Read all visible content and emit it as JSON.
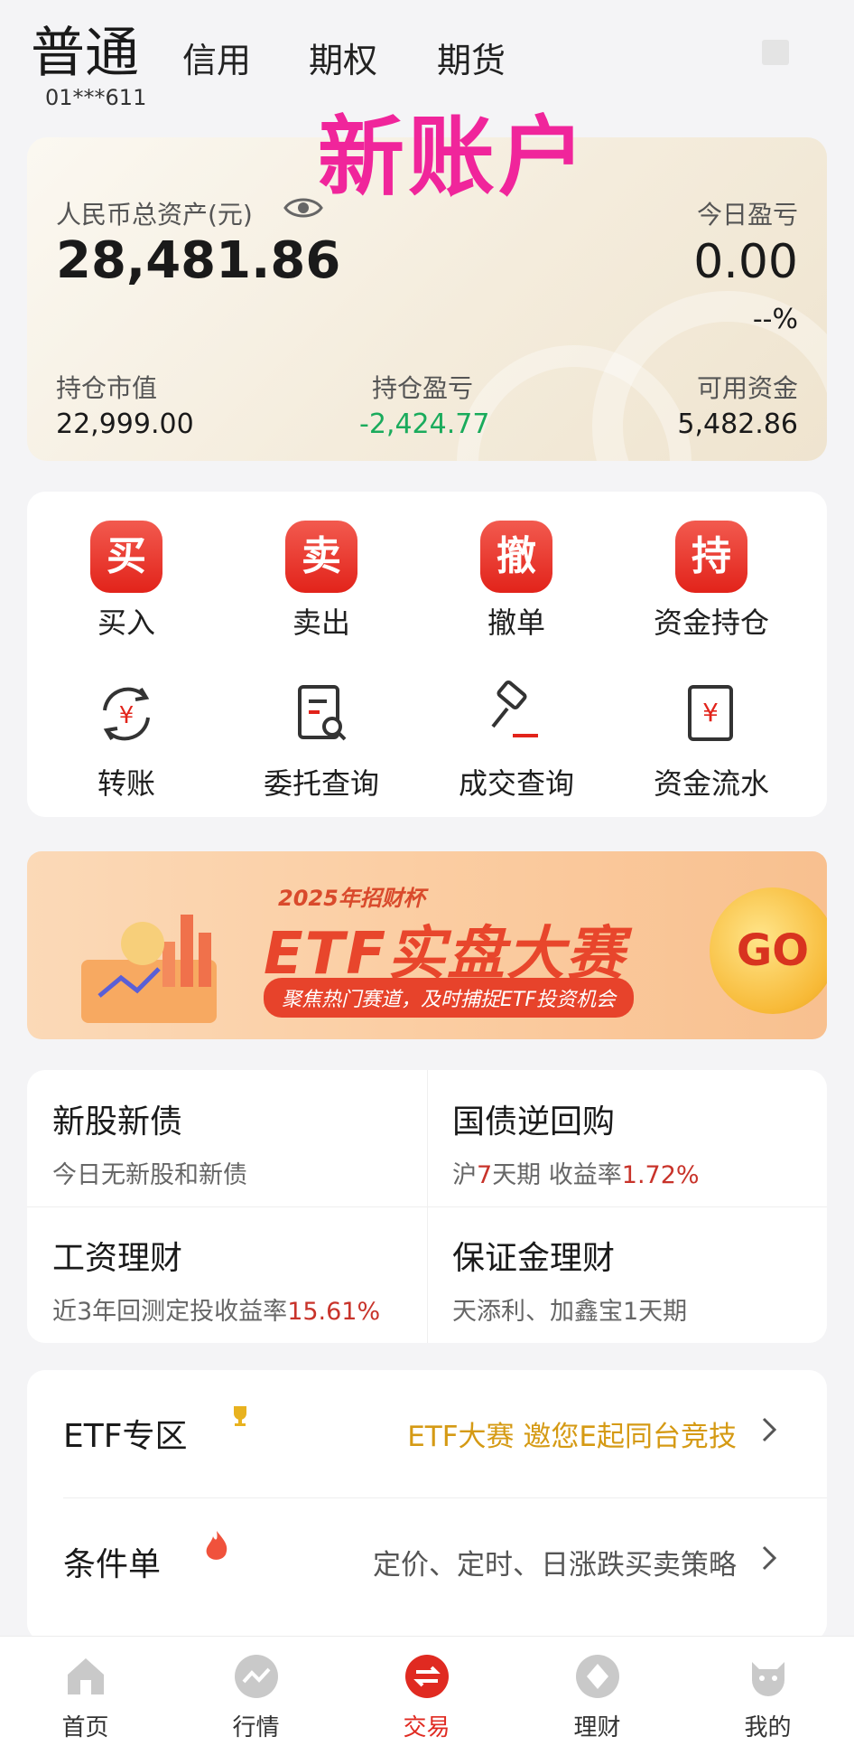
{
  "top_tabs": {
    "main": "普通",
    "items": [
      "信用",
      "期权",
      "期货"
    ],
    "account_no": "01***611",
    "overlay_label": "新账户"
  },
  "asset": {
    "total_label": "人民币总资产(元)",
    "total_value": "28,481.86",
    "today_pl_label": "今日盈亏",
    "today_pl_value": "0.00",
    "today_pl_pct": "--%",
    "market_value_label": "持仓市值",
    "market_value": "22,999.00",
    "position_pl_label": "持仓盈亏",
    "position_pl": "-2,424.77",
    "available_label": "可用资金",
    "available": "5,482.86",
    "colors": {
      "loss": "#1aab5c",
      "accent": "#e2231a"
    }
  },
  "actions": {
    "row1": [
      {
        "badge": "买",
        "label": "买入"
      },
      {
        "badge": "卖",
        "label": "卖出"
      },
      {
        "badge": "撤",
        "label": "撤单"
      },
      {
        "badge": "持",
        "label": "资金持仓"
      }
    ],
    "row2": [
      {
        "icon": "transfer-icon",
        "label": "转账"
      },
      {
        "icon": "order-query-icon",
        "label": "委托查询"
      },
      {
        "icon": "deal-query-icon",
        "label": "成交查询"
      },
      {
        "icon": "fund-flow-icon",
        "label": "资金流水"
      }
    ]
  },
  "banner": {
    "small": "2025年招财杯",
    "title": "ETF实盘大赛",
    "subtitle": "聚焦热门赛道，及时捕捉ETF投资机会",
    "go": "GO"
  },
  "services": [
    {
      "title": "新股新债",
      "sub_pre": "今日无新股和新债",
      "sub_hl": "",
      "sub_post": ""
    },
    {
      "title": "国债逆回购",
      "sub_pre": "沪",
      "sub_hl": "7",
      "sub_post": "天期 收益率",
      "sub_hl2": "1.72%"
    },
    {
      "title": "工资理财",
      "sub_pre": "近3年回测定投收益率",
      "sub_hl": "15.61%",
      "sub_post": ""
    },
    {
      "title": "保证金理财",
      "sub_pre": "天添利、加鑫宝1天期",
      "sub_hl": "",
      "sub_post": ""
    }
  ],
  "list_rows": [
    {
      "title": "ETF专区",
      "icon": "trophy-icon",
      "desc": "ETF大赛 邀您E起同台竞技"
    },
    {
      "title": "条件单",
      "icon": "fire-icon",
      "desc": "定价、定时、日涨跌买卖策略"
    }
  ],
  "bottom_nav": [
    {
      "icon": "home-icon",
      "label": "首页"
    },
    {
      "icon": "market-icon",
      "label": "行情"
    },
    {
      "icon": "trade-icon",
      "label": "交易",
      "active": true
    },
    {
      "icon": "wealth-icon",
      "label": "理财"
    },
    {
      "icon": "profile-icon",
      "label": "我的"
    }
  ]
}
